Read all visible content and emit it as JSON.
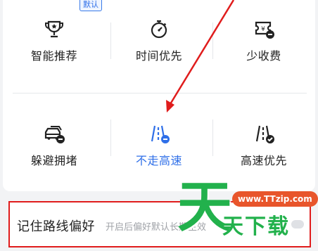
{
  "route_options": {
    "row1": [
      {
        "label": "智能推荐",
        "icon": "trophy-icon",
        "badge": "默认"
      },
      {
        "label": "时间优先",
        "icon": "stopwatch-icon"
      },
      {
        "label": "少收费",
        "icon": "toll-ticket-icon"
      }
    ],
    "row2": [
      {
        "label": "躲避拥堵",
        "icon": "car-traffic-icon"
      },
      {
        "label": "不走高速",
        "icon": "no-highway-icon",
        "selected": true
      },
      {
        "label": "高速优先",
        "icon": "highway-check-icon"
      }
    ]
  },
  "remember_route": {
    "title": "记住路线偏好",
    "description": "开启后偏好默认长期生效"
  },
  "watermark": {
    "big_char": "天",
    "url": "www.TTzip.com",
    "text": "天下载"
  },
  "colors": {
    "accent": "#2f6fe8",
    "annotation_red": "#e01c1c",
    "watermark_green": "#22b14c",
    "watermark_orange": "#e8552b"
  }
}
